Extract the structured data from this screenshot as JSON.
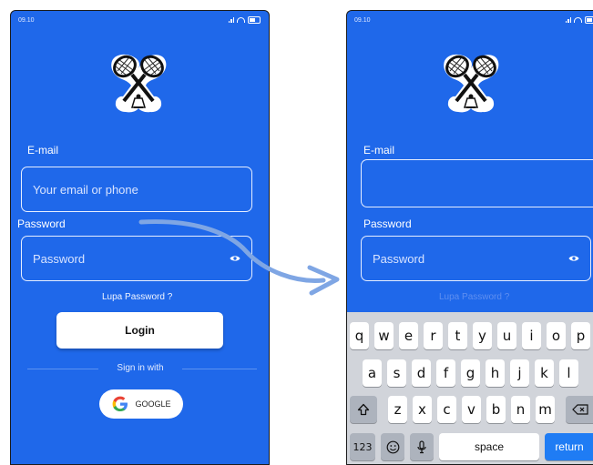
{
  "left_screen": {
    "status_time": "09.10",
    "email_label": "E-mail",
    "email_placeholder": "Your email or phone",
    "password_label": "Password",
    "password_placeholder": "Password",
    "forgot_password": "Lupa Password ?",
    "login_button": "Login",
    "signin_with": "Sign in with",
    "google_button": "GOOGLE"
  },
  "right_screen": {
    "status_time": "09.10",
    "email_label": "E-mail",
    "password_label": "Password",
    "password_placeholder": "Password",
    "forgot_password": "Lupa Password ?",
    "keyboard": {
      "row1": [
        "q",
        "w",
        "e",
        "r",
        "t",
        "y",
        "u",
        "i",
        "o",
        "p"
      ],
      "row2": [
        "a",
        "s",
        "d",
        "f",
        "g",
        "h",
        "j",
        "k",
        "l"
      ],
      "row3": [
        "z",
        "x",
        "c",
        "v",
        "b",
        "n",
        "m"
      ],
      "numbers_key": "123",
      "space_key": "space",
      "return_key": "return"
    }
  },
  "colors": {
    "background_blue": "#1f68ea",
    "keyboard_gray": "#d1d4da",
    "return_blue": "#1f7cf4",
    "arrow": "#7fa6e4"
  }
}
